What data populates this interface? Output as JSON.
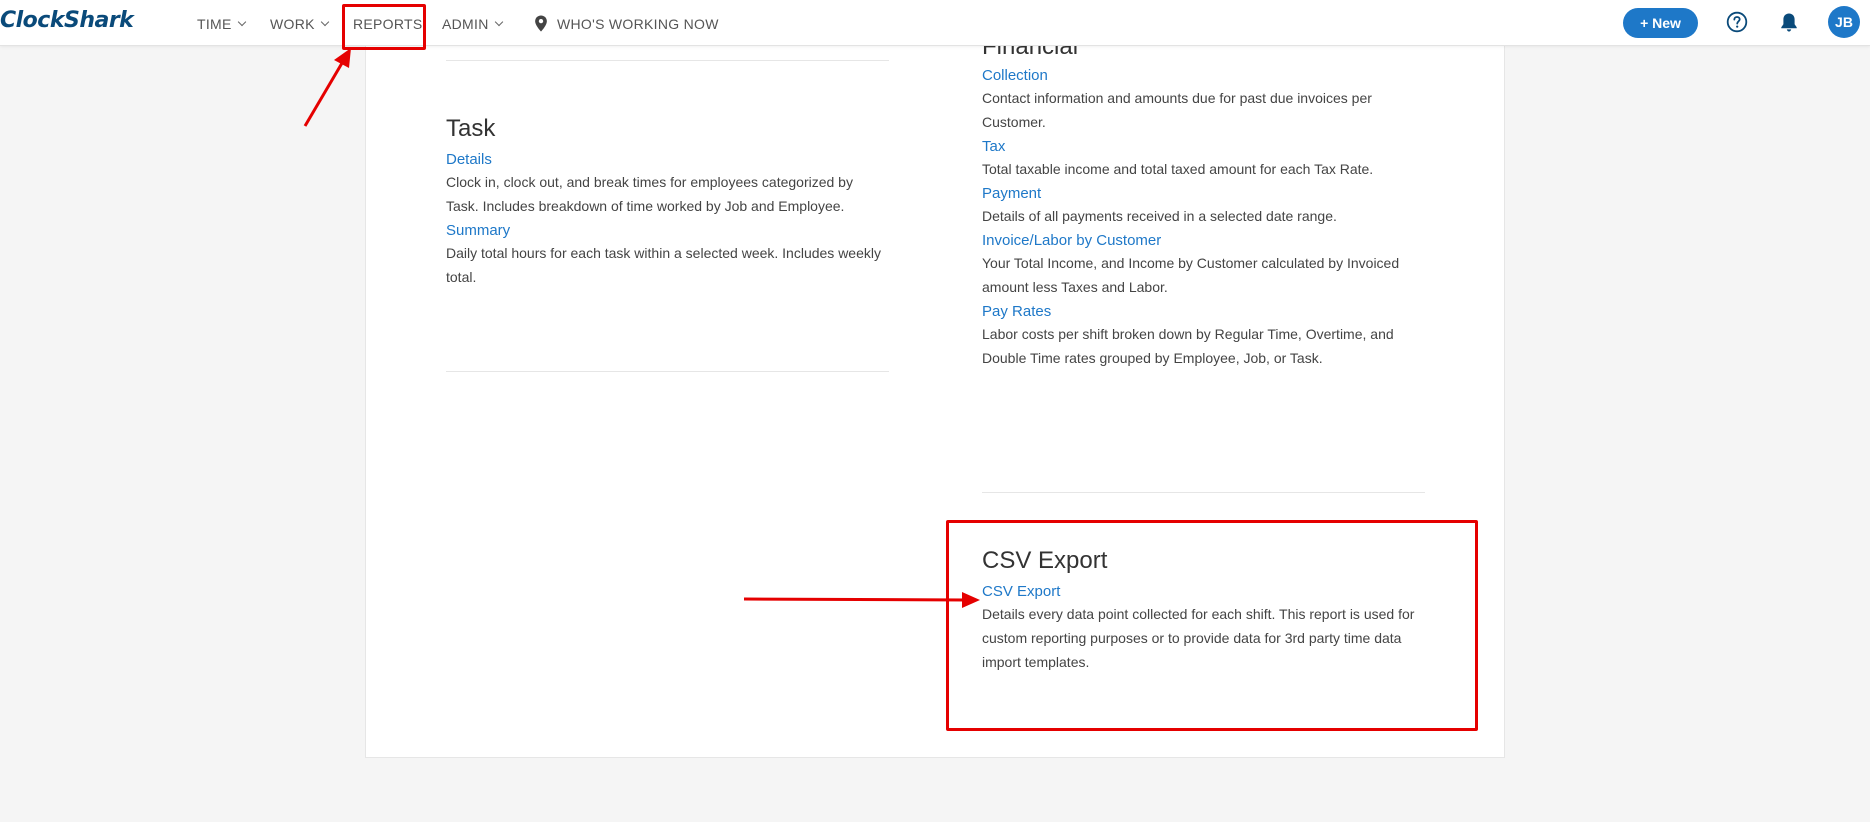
{
  "app": {
    "logo_text": "ClockShark"
  },
  "nav": {
    "time_label": "TIME",
    "work_label": "WORK",
    "reports_label": "REPORTS",
    "admin_label": "ADMIN",
    "whos_working_label": "WHO'S WORKING NOW",
    "new_button_label": "+ New",
    "avatar_initials": "JB",
    "icons": [
      "chevron-down-icon",
      "map-pin-icon",
      "help-circle-icon",
      "bell-icon"
    ]
  },
  "sections": {
    "financial": {
      "title": "Financial",
      "reports": [
        {
          "name": "Collection",
          "description": "Contact information and amounts due for past due invoices per Customer."
        },
        {
          "name": "Tax",
          "description": "Total taxable income and total taxed amount for each Tax Rate."
        },
        {
          "name": "Payment",
          "description": "Details of all payments received in a selected date range."
        },
        {
          "name": "Invoice/Labor by Customer",
          "description": "Your Total Income, and Income by Customer calculated by Invoiced amount less Taxes and Labor."
        },
        {
          "name": "Pay Rates",
          "description": "Labor costs per shift broken down by Regular Time, Overtime, and Double Time rates grouped by Employee, Job, or Task."
        }
      ]
    },
    "task": {
      "title": "Task",
      "reports": [
        {
          "name": "Details",
          "description": "Clock in, clock out, and break times for employees categorized by Task. Includes breakdown of time worked by Job and Employee."
        },
        {
          "name": "Summary",
          "description": "Daily total hours for each task within a selected week. Includes weekly total."
        }
      ]
    },
    "csv_export": {
      "title": "CSV Export",
      "reports": [
        {
          "name": "CSV Export",
          "description": "Details every data point collected for each shift. This report is used for custom reporting purposes or to provide data for 3rd party time data import templates."
        }
      ]
    }
  },
  "colors": {
    "link": "#1e78c8",
    "logo": "#0a4a7a",
    "annotation": "#e50000",
    "background": "#f5f5f5"
  }
}
